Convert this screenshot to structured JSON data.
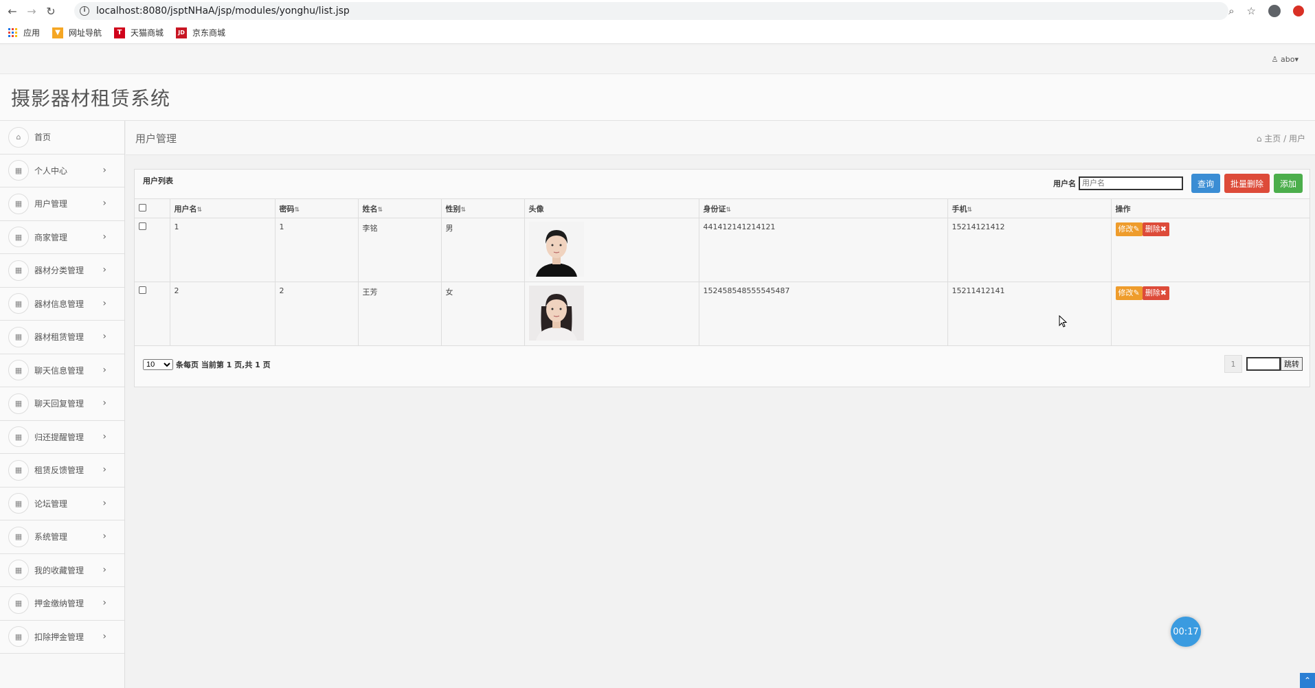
{
  "browser": {
    "url": "localhost:8080/jsptNHaA/jsp/modules/yonghu/list.jsp",
    "bookmarks": [
      {
        "label": "应用",
        "icon": "apps-grid-icon"
      },
      {
        "label": "网址导航",
        "icon": "nav-logo-icon",
        "color": "#f5a623"
      },
      {
        "label": "天猫商城",
        "icon": "tmall-logo-icon",
        "color": "#d0021b",
        "glyph": "T"
      },
      {
        "label": "京东商城",
        "icon": "jd-logo-icon",
        "color": "#c81623",
        "glyph": "JD"
      }
    ]
  },
  "app": {
    "title": "摄影器材租赁系统",
    "user": "abo"
  },
  "sidebar": {
    "items": [
      {
        "label": "首页",
        "icon": "home-icon",
        "expandable": false
      },
      {
        "label": "个人中心",
        "icon": "grid-icon",
        "expandable": true
      },
      {
        "label": "用户管理",
        "icon": "grid-icon",
        "expandable": true
      },
      {
        "label": "商家管理",
        "icon": "grid-icon",
        "expandable": true
      },
      {
        "label": "器材分类管理",
        "icon": "grid-icon",
        "expandable": true
      },
      {
        "label": "器材信息管理",
        "icon": "grid-icon",
        "expandable": true
      },
      {
        "label": "器材租赁管理",
        "icon": "grid-icon",
        "expandable": true
      },
      {
        "label": "聊天信息管理",
        "icon": "grid-icon",
        "expandable": true
      },
      {
        "label": "聊天回复管理",
        "icon": "grid-icon",
        "expandable": true
      },
      {
        "label": "归还提醒管理",
        "icon": "grid-icon",
        "expandable": true
      },
      {
        "label": "租赁反馈管理",
        "icon": "grid-icon",
        "expandable": true
      },
      {
        "label": "论坛管理",
        "icon": "grid-icon",
        "expandable": true
      },
      {
        "label": "系统管理",
        "icon": "grid-icon",
        "expandable": true
      },
      {
        "label": "我的收藏管理",
        "icon": "grid-icon",
        "expandable": true
      },
      {
        "label": "押金缴纳管理",
        "icon": "grid-icon",
        "expandable": true
      },
      {
        "label": "扣除押金管理",
        "icon": "grid-icon",
        "expandable": true
      }
    ]
  },
  "page": {
    "title": "用户管理",
    "breadcrumb_home": "主页",
    "breadcrumb_sep": "/",
    "breadcrumb_current": "用户"
  },
  "panel": {
    "title": "用户列表",
    "search_label": "用户名",
    "search_placeholder": "用户名",
    "btn_query": "查询",
    "btn_batch_delete": "批量删除",
    "btn_add": "添加"
  },
  "table": {
    "columns": [
      "用户名",
      "密码",
      "姓名",
      "性别",
      "头像",
      "身份证",
      "手机",
      "操作"
    ],
    "sortable": [
      true,
      true,
      true,
      true,
      false,
      true,
      true,
      false
    ],
    "rows": [
      {
        "username": "1",
        "password": "1",
        "name": "李铭",
        "gender": "男",
        "avatar": "male-portrait",
        "id_card": "441412141214121",
        "phone": "15214121412",
        "edit": "修改",
        "delete": "删除"
      },
      {
        "username": "2",
        "password": "2",
        "name": "王芳",
        "gender": "女",
        "avatar": "female-portrait",
        "id_card": "152458548555545487",
        "phone": "15211412141",
        "edit": "修改",
        "delete": "删除"
      }
    ]
  },
  "pager": {
    "page_size": "10",
    "page_size_options": [
      "10"
    ],
    "info": "条每页 当前第 1 页,共 1 页",
    "current_page": "1",
    "jump_label": "跳转"
  },
  "timer": "00:17",
  "colors": {
    "primary": "#3a8dd4",
    "danger": "#dd4b39",
    "success": "#4cae4c",
    "warning": "#ee9c2c"
  }
}
